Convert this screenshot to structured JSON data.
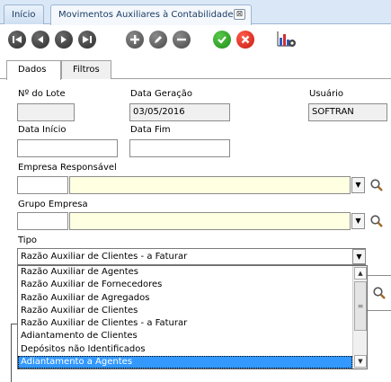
{
  "tabs": {
    "home_label": "Início",
    "active_label": "Movimentos Auxiliares à Contabilidade",
    "close_symbol": "⊠"
  },
  "toolbar": {
    "icons": [
      "first-record-icon",
      "previous-record-icon",
      "next-record-icon",
      "last-record-icon",
      "add-icon",
      "edit-icon",
      "remove-icon",
      "confirm-icon",
      "cancel-icon",
      "report-settings-icon"
    ]
  },
  "form_tabs": {
    "dados": "Dados",
    "filtros": "Filtros"
  },
  "fields": {
    "lote_label": "Nº do Lote",
    "lote_value": "",
    "data_geracao_label": "Data Geração",
    "data_geracao_value": "03/05/2016",
    "usuario_label": "Usuário",
    "usuario_value": "SOFTRAN",
    "data_inicio_label": "Data Início",
    "data_inicio_value": "",
    "data_fim_label": "Data Fim",
    "data_fim_value": "",
    "empresa_label": "Empresa Responsável",
    "empresa_code": "",
    "empresa_name": "",
    "grupo_label": "Grupo Empresa",
    "grupo_code": "",
    "grupo_name": "",
    "tipo_label": "Tipo",
    "tipo_value": "Razão Auxiliar de Clientes - a Faturar"
  },
  "tipo_options": [
    "Razão Auxiliar de Agentes",
    "Razão Auxiliar de Fornecedores",
    "Razão Auxiliar de Agregados",
    "Razão Auxiliar de Clientes",
    "Razão Auxiliar de Clientes - a Faturar",
    "Adiantamento de Clientes",
    "Depósitos não Identificados",
    "Adiantamento a Agentes"
  ],
  "colors": {
    "accent": "#3399ff",
    "lookup_bg": "#ffffe1",
    "tabbar_bg": "#d9e7f6"
  }
}
